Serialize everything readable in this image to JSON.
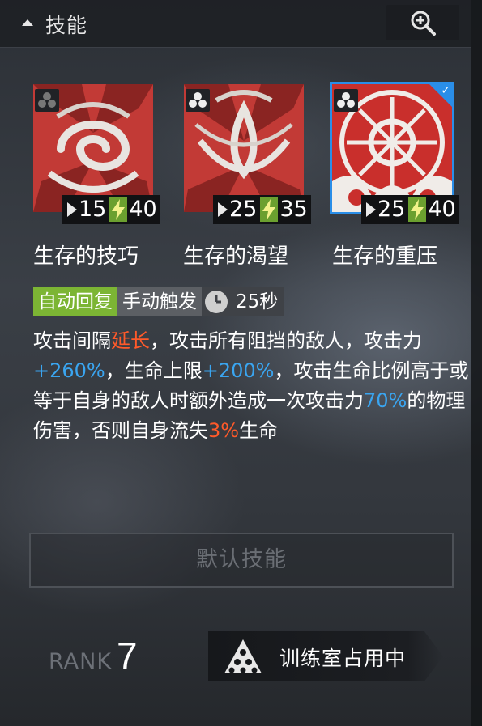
{
  "header": {
    "title": "技能",
    "collapse_icon": "caret-up-icon",
    "zoom_icon": "zoom-in-icon"
  },
  "skills": [
    {
      "name": "生存的技巧",
      "charge_time": "15",
      "sp_cost": "40",
      "selected": false
    },
    {
      "name": "生存的渴望",
      "charge_time": "25",
      "sp_cost": "35",
      "selected": false
    },
    {
      "name": "生存的重压",
      "charge_time": "25",
      "sp_cost": "40",
      "selected": true
    }
  ],
  "tags": {
    "recovery": "自动回复",
    "trigger": "手动触发",
    "duration": "25秒"
  },
  "description": {
    "p1": "攻击间隔",
    "p2": "延长",
    "p3": "，攻击所有阻挡的敌人，攻击力",
    "p4": "+260%",
    "p5": "，生命上限",
    "p6": "+200%",
    "p7": "，攻击生命比例高于或等于自身的敌人时额外造成一次攻击力",
    "p8": "70%",
    "p9": "的物理伤害，否则自身流失",
    "p10": "3%",
    "p11": "生命"
  },
  "default_button": "默认技能",
  "rank": {
    "label": "RANK",
    "value": "7"
  },
  "training": {
    "label": "训练室占用中"
  },
  "colors": {
    "auto_tag": "#7cb534",
    "highlight_red": "#ff5a2a",
    "highlight_blue": "#3aa5f0",
    "selected_border": "#2a8ee8",
    "sp_green": "#6ba02f"
  }
}
